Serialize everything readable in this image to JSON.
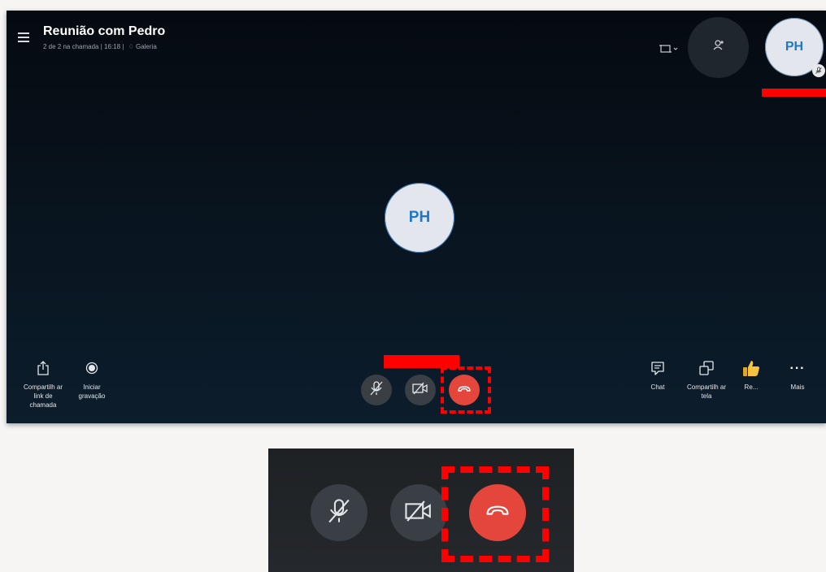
{
  "header": {
    "title": "Reunião com Pedro",
    "subtitle_status": "2 de 2 na chamada | 16:18 |",
    "subtitle_view": "Galeria"
  },
  "participant": {
    "initials": "PH"
  },
  "bottom_left": [
    {
      "label": "Compartilh ar link de chamada",
      "icon": "share-icon"
    },
    {
      "label": "Iniciar gravação",
      "icon": "record-icon"
    }
  ],
  "bottom_right": {
    "chat": "Chat",
    "share_screen": "Compartilh ar tela",
    "react": "Re...",
    "more": "Mais"
  },
  "colors": {
    "end_call": "#e5463b",
    "control_bg": "#3a3f45",
    "accent": "#1e78c8",
    "annotation": "#ff0000"
  },
  "icons": [
    "hamburger-menu-icon",
    "screen-resize-icon",
    "add-person-icon",
    "microphone-muted-icon",
    "camera-off-icon",
    "hang-up-icon",
    "chat-icon",
    "share-screen-icon",
    "thumbs-up-icon",
    "more-icon"
  ]
}
